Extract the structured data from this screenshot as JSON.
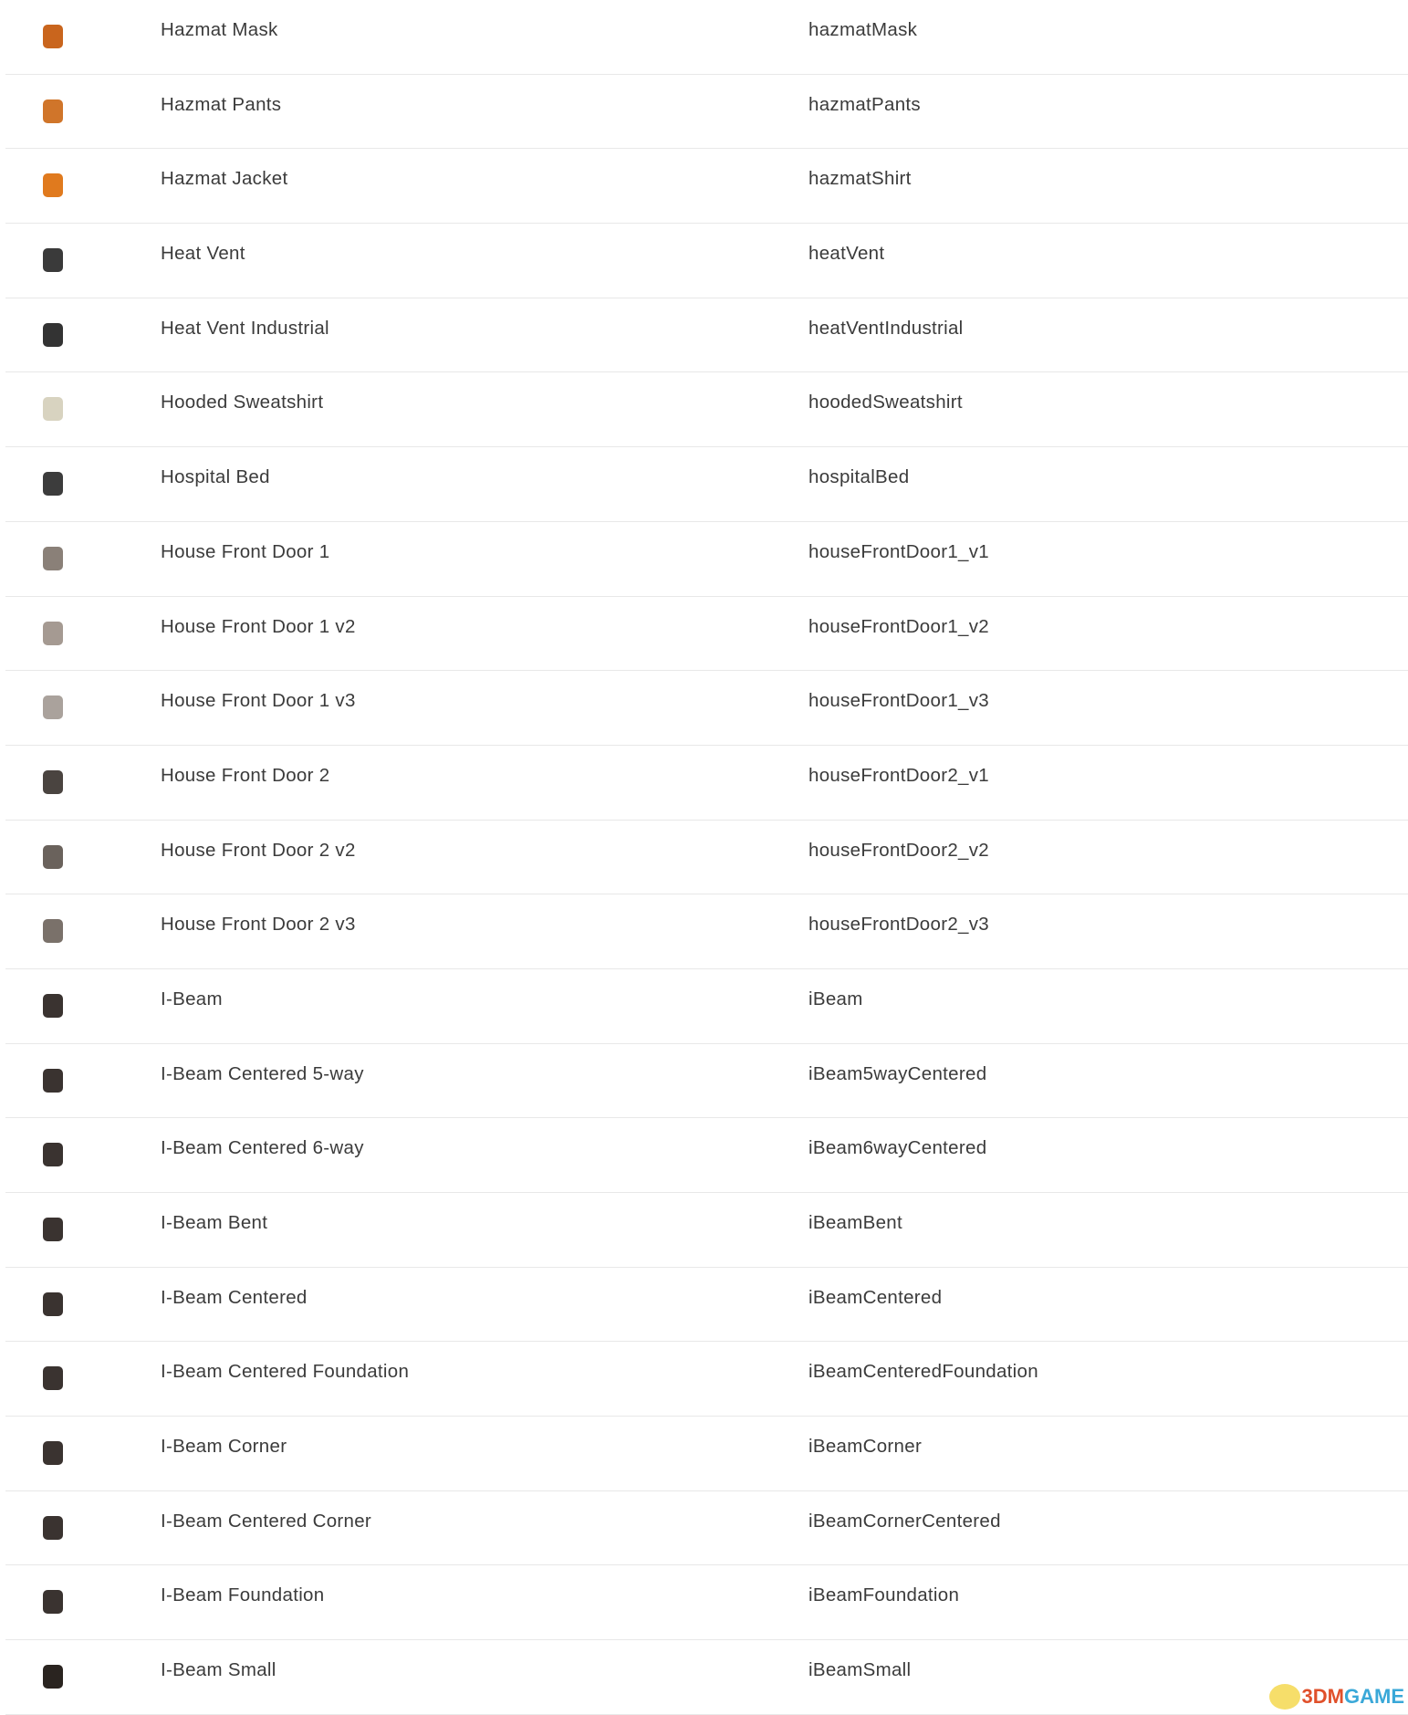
{
  "rows": [
    {
      "name": "Hazmat Mask",
      "id": "hazmatMask",
      "icon": "hazmat-mask-icon",
      "color": "#c9651d"
    },
    {
      "name": "Hazmat Pants",
      "id": "hazmatPants",
      "icon": "hazmat-pants-icon",
      "color": "#d0752a"
    },
    {
      "name": "Hazmat Jacket",
      "id": "hazmatShirt",
      "icon": "hazmat-jacket-icon",
      "color": "#e07a1e"
    },
    {
      "name": "Heat Vent",
      "id": "heatVent",
      "icon": "heat-vent-icon",
      "color": "#3a3a3a"
    },
    {
      "name": "Heat Vent Industrial",
      "id": "heatVentIndustrial",
      "icon": "heat-vent-industrial-icon",
      "color": "#333333"
    },
    {
      "name": "Hooded Sweatshirt",
      "id": "hoodedSweatshirt",
      "icon": "hooded-sweatshirt-icon",
      "color": "#d8d3c0"
    },
    {
      "name": "Hospital Bed",
      "id": "hospitalBed",
      "icon": "hospital-bed-icon",
      "color": "#3c3c3c"
    },
    {
      "name": "House Front Door 1",
      "id": "houseFrontDoor1_v1",
      "icon": "door-icon",
      "color": "#8a8078"
    },
    {
      "name": "House Front Door 1 v2",
      "id": "houseFrontDoor1_v2",
      "icon": "door-icon",
      "color": "#a59a92"
    },
    {
      "name": "House Front Door 1 v3",
      "id": "houseFrontDoor1_v3",
      "icon": "door-icon",
      "color": "#aaa29c"
    },
    {
      "name": "House Front Door 2",
      "id": "houseFrontDoor2_v1",
      "icon": "door-icon",
      "color": "#4a4440"
    },
    {
      "name": "House Front Door 2 v2",
      "id": "houseFrontDoor2_v2",
      "icon": "door-icon",
      "color": "#6a625c"
    },
    {
      "name": "House Front Door 2 v3",
      "id": "houseFrontDoor2_v3",
      "icon": "door-icon",
      "color": "#7a716a"
    },
    {
      "name": "I-Beam",
      "id": "iBeam",
      "icon": "i-beam-icon",
      "color": "#3a3330"
    },
    {
      "name": "I-Beam Centered 5-way",
      "id": "iBeam5wayCentered",
      "icon": "i-beam-icon",
      "color": "#3a3330"
    },
    {
      "name": "I-Beam Centered 6-way",
      "id": "iBeam6wayCentered",
      "icon": "i-beam-icon",
      "color": "#3a3330"
    },
    {
      "name": "I-Beam Bent",
      "id": "iBeamBent",
      "icon": "i-beam-icon",
      "color": "#3a3330"
    },
    {
      "name": "I-Beam Centered",
      "id": "iBeamCentered",
      "icon": "i-beam-icon",
      "color": "#3a3330"
    },
    {
      "name": "I-Beam Centered Foundation",
      "id": "iBeamCenteredFoundation",
      "icon": "i-beam-icon",
      "color": "#3a3330"
    },
    {
      "name": "I-Beam Corner",
      "id": "iBeamCorner",
      "icon": "i-beam-icon",
      "color": "#3a3330"
    },
    {
      "name": "I-Beam Centered Corner",
      "id": "iBeamCornerCentered",
      "icon": "i-beam-icon",
      "color": "#3a3330"
    },
    {
      "name": "I-Beam Foundation",
      "id": "iBeamFoundation",
      "icon": "i-beam-icon",
      "color": "#3a3330"
    },
    {
      "name": "I-Beam Small",
      "id": "iBeamSmall",
      "icon": "i-beam-icon",
      "color": "#2a2420"
    }
  ],
  "watermark": {
    "part1": "3DM",
    "part2": "GAME"
  }
}
